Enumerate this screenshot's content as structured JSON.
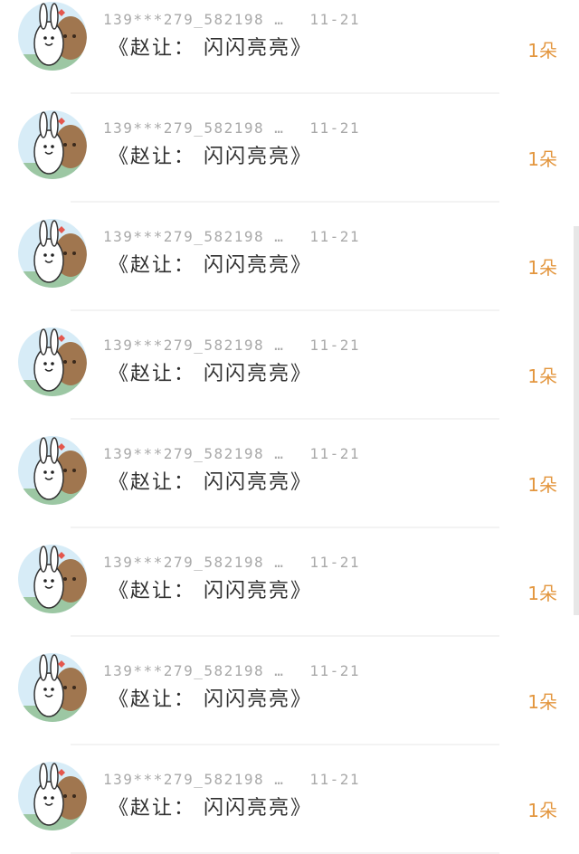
{
  "rows": [
    {
      "meta": "139***279_582198 …",
      "date": "11-21",
      "title": "《赵让： 闪闪亮亮》",
      "count": "1朵"
    },
    {
      "meta": "139***279_582198 …",
      "date": "11-21",
      "title": "《赵让： 闪闪亮亮》",
      "count": "1朵"
    },
    {
      "meta": "139***279_582198 …",
      "date": "11-21",
      "title": "《赵让： 闪闪亮亮》",
      "count": "1朵"
    },
    {
      "meta": "139***279_582198 …",
      "date": "11-21",
      "title": "《赵让： 闪闪亮亮》",
      "count": "1朵"
    },
    {
      "meta": "139***279_582198 …",
      "date": "11-21",
      "title": "《赵让： 闪闪亮亮》",
      "count": "1朵"
    },
    {
      "meta": "139***279_582198 …",
      "date": "11-21",
      "title": "《赵让： 闪闪亮亮》",
      "count": "1朵"
    },
    {
      "meta": "139***279_582198 …",
      "date": "11-21",
      "title": "《赵让： 闪闪亮亮》",
      "count": "1朵"
    },
    {
      "meta": "139***279_582198 …",
      "date": "11-21",
      "title": "《赵让： 闪闪亮亮》",
      "count": "1朵"
    }
  ],
  "avatar_icon": "rabbit-and-bear-icon",
  "colors": {
    "count": "#e3963e",
    "meta": "#a9a9a9",
    "title": "#2f2f2f"
  }
}
